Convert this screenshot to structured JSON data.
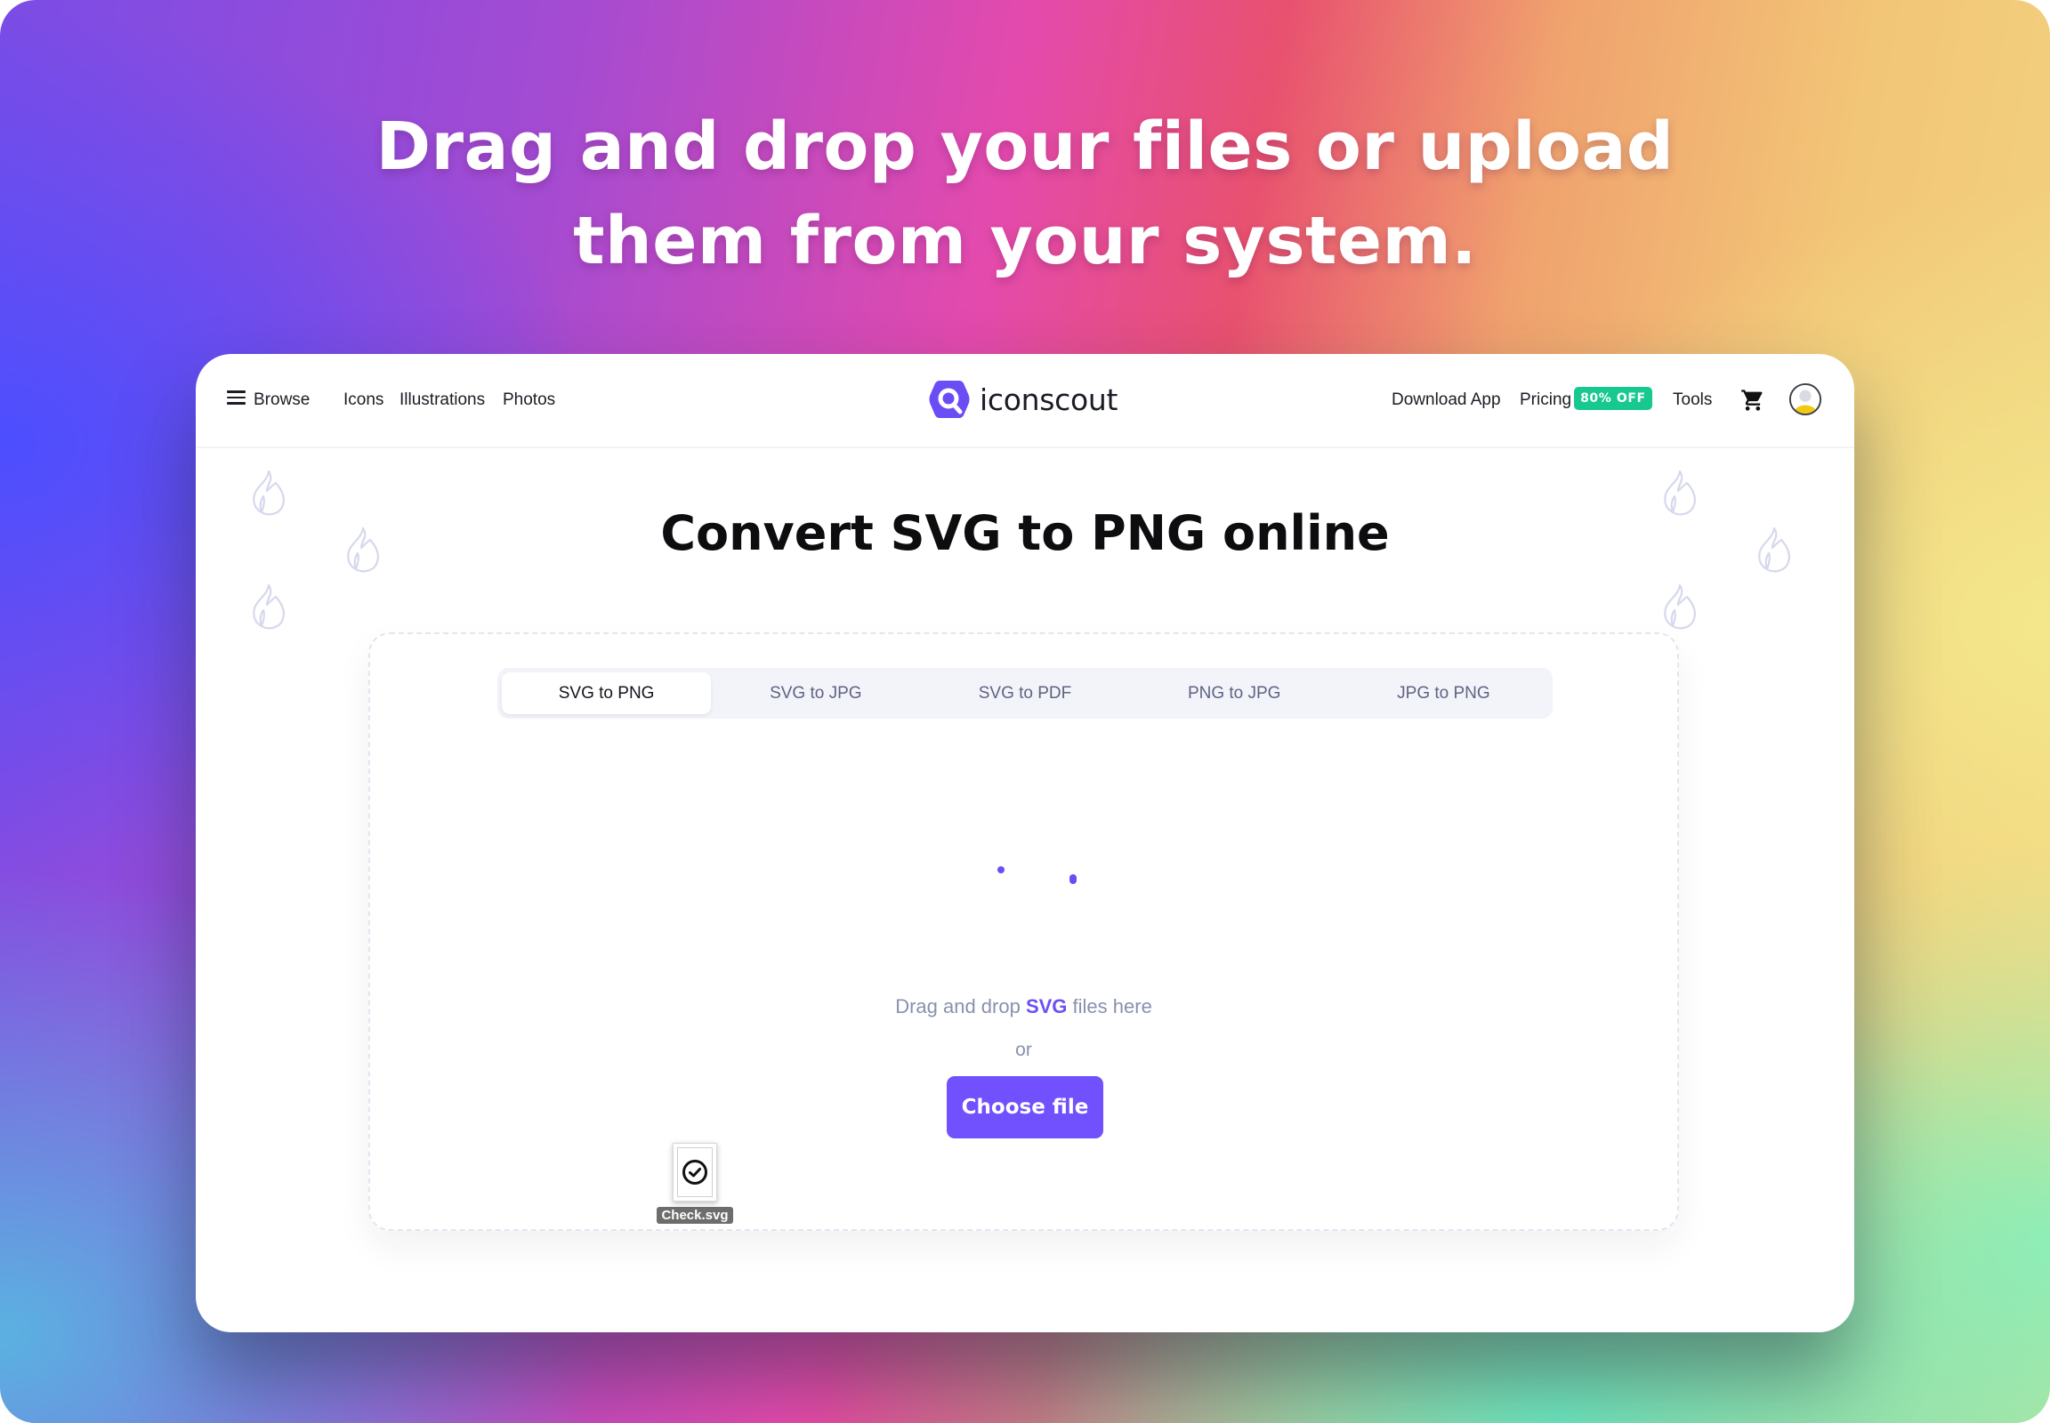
{
  "headline": {
    "line1": "Drag and drop your files or upload",
    "line2": "them from your system."
  },
  "nav": {
    "browse_label": "Browse",
    "links": [
      "Icons",
      "Illustrations",
      "Photos"
    ],
    "logo_text": "iconscout",
    "download_app": "Download App",
    "pricing": "Pricing",
    "pricing_badge": "80% OFF",
    "tools": "Tools",
    "icons": {
      "menu": "hamburger-menu-icon",
      "cart": "shopping-cart-icon",
      "avatar": "user-avatar-icon",
      "logo": "iconscout-logo-icon"
    }
  },
  "page": {
    "title": "Convert SVG to PNG online",
    "decor_icon": "flame-outline-icon"
  },
  "converter": {
    "tabs": [
      {
        "label": "SVG to PNG",
        "active": true
      },
      {
        "label": "SVG to JPG",
        "active": false
      },
      {
        "label": "SVG to PDF",
        "active": false
      },
      {
        "label": "PNG to JPG",
        "active": false
      },
      {
        "label": "JPG to PNG",
        "active": false
      }
    ],
    "drop_text_before": "Drag and drop ",
    "drop_text_highlight": "SVG",
    "drop_text_after": " files here",
    "or_text": "or",
    "choose_button": "Choose file",
    "loading_indicator": "spinner-dots"
  },
  "dragged_file": {
    "name": "Check.svg",
    "icon": "check-circle-icon"
  },
  "colors": {
    "accent": "#7150fd",
    "badge": "#18c98f",
    "logo": "#6c4cf5",
    "flame": "#d6d8ec"
  }
}
